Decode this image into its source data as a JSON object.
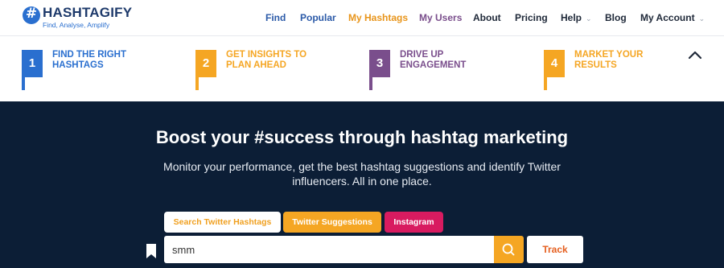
{
  "header": {
    "logo": {
      "name": "HASHTAGIFY",
      "tagline": "Find, Analyse, Amplify",
      "icon": "hashtag-globe-icon"
    },
    "nav": [
      {
        "label": "Find"
      },
      {
        "label": "Popular"
      },
      {
        "label": "My Hashtags"
      },
      {
        "label": "My Users"
      },
      {
        "label": "About"
      },
      {
        "label": "Pricing"
      },
      {
        "label": "Help"
      },
      {
        "label": "Blog"
      },
      {
        "label": "My Account"
      }
    ]
  },
  "steps": [
    {
      "num": "1",
      "line1": "FIND THE RIGHT",
      "line2": "HASHTAGS",
      "color": "#2a6fcf"
    },
    {
      "num": "2",
      "line1": "GET INSIGHTS TO",
      "line2": "PLAN AHEAD",
      "color": "#f5a623"
    },
    {
      "num": "3",
      "line1": "DRIVE UP",
      "line2": "ENGAGEMENT",
      "color": "#7a4e8c"
    },
    {
      "num": "4",
      "line1": "MARKET YOUR",
      "line2": "RESULTS",
      "color": "#f5a623"
    }
  ],
  "hero": {
    "title": "Boost your #success through hashtag marketing",
    "subtitle": "Monitor your performance, get the best hashtag suggestions and identify Twitter influencers. All in one place.",
    "tabs": [
      {
        "label": "Search Twitter Hashtags"
      },
      {
        "label": "Twitter Suggestions"
      },
      {
        "label": "Instagram"
      }
    ],
    "search": {
      "value": "smm"
    },
    "track_label": "Track"
  },
  "colors": {
    "hero_bg": "#0c1e36",
    "accent_orange": "#f5a623",
    "instagram_pink": "#d81b60",
    "brand_blue": "#2a6fcf"
  }
}
